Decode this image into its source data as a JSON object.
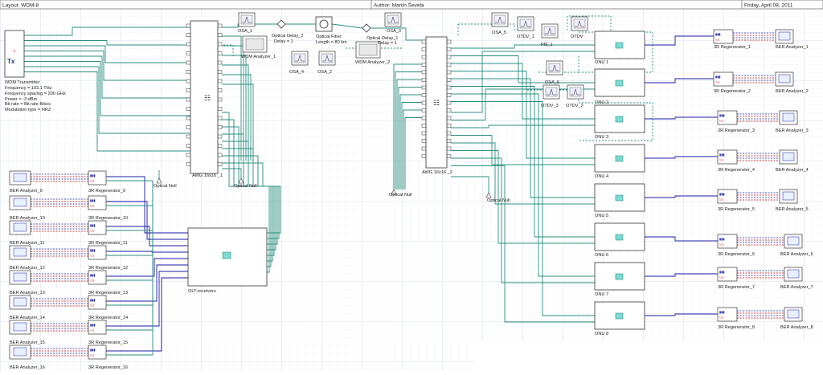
{
  "header": {
    "layout": "Layout: WDM-8",
    "author": "Author: Martin Ševela",
    "date": "Friday, April 08, 2011"
  },
  "transmitter": {
    "icon_text": "Tx",
    "title": "WDM Transmitter",
    "params": [
      "Frequency = 193.1  THz",
      "Frequency spacing = 200  GHz",
      "Power = -3  dBm",
      "Bit rate = Bit rate  Bits/s",
      "Modulation type = NRZ"
    ]
  },
  "awg1": {
    "label": "AWG 16x16 _1"
  },
  "awg2": {
    "label": "AWG 16x16 _2"
  },
  "optical_nulls": [
    "Optical Null",
    "Optical Null",
    "Optical Null",
    "Optical Null"
  ],
  "osa": [
    "OSA_1",
    "OSA_4",
    "OSA_2",
    "OSA_3",
    "OSA_5",
    "OSA_6"
  ],
  "wdm_analyzers": [
    "WDM Analyzer_1",
    "WDM Analyzer_2"
  ],
  "delay1": [
    "Optical Delay_2",
    "Delay = 1"
  ],
  "delay2": [
    "Optical Delay_1",
    "Delay = 1"
  ],
  "fiber": [
    "Optical Fiber",
    "Length = 80  km"
  ],
  "otdv": [
    "OTDV_1",
    "OTDV",
    "OTDV_3",
    "OTDV_2"
  ],
  "pm": "PM_1",
  "onus": [
    "ONU 1",
    "ONU 2",
    "ONU 3",
    "ONU 4",
    "ONU 5",
    "ONU 6",
    "ONU 7",
    "ONU 8"
  ],
  "regen_right": [
    "3R Regenerator_1",
    "3R Regenerator_2",
    "3R Regenerator_3",
    "3R Regenerator_4",
    "3R Regenerator_5",
    "3R Regenerator_6",
    "3R Regenerator_7",
    "3R Regenerator_8"
  ],
  "ber_right": [
    "BER Analyzer_1",
    "BER Analyzer_2",
    "BER Analyzer_3",
    "BER Analyzer_4",
    "BER Analyzer_5",
    "BER Analyzer_6",
    "BER Analyzer_7",
    "BER Analyzer_8"
  ],
  "regen_left": [
    "3R Regenerator_9",
    "3R Regenerator_10",
    "3R Regenerator_11",
    "3R Regenerator_12",
    "3R Regenerator_13",
    "3R Regenerator_14",
    "3R Regenerator_15",
    "3R Regenerator_16"
  ],
  "ber_left": [
    "BER Analyzer_9",
    "BER Analyzer_10",
    "BER Analyzer_11",
    "BER Analyzer_12",
    "BER Analyzer_13",
    "BER Analyzer_14",
    "BER Analyzer_15",
    "BER Analyzer_16"
  ],
  "olt": {
    "label": "OLT-receivers"
  },
  "colors": {
    "optical": "#2a8f7f",
    "electrical": "#1a1aa8",
    "grid": "#d6deee",
    "box": "#1f6f63"
  }
}
